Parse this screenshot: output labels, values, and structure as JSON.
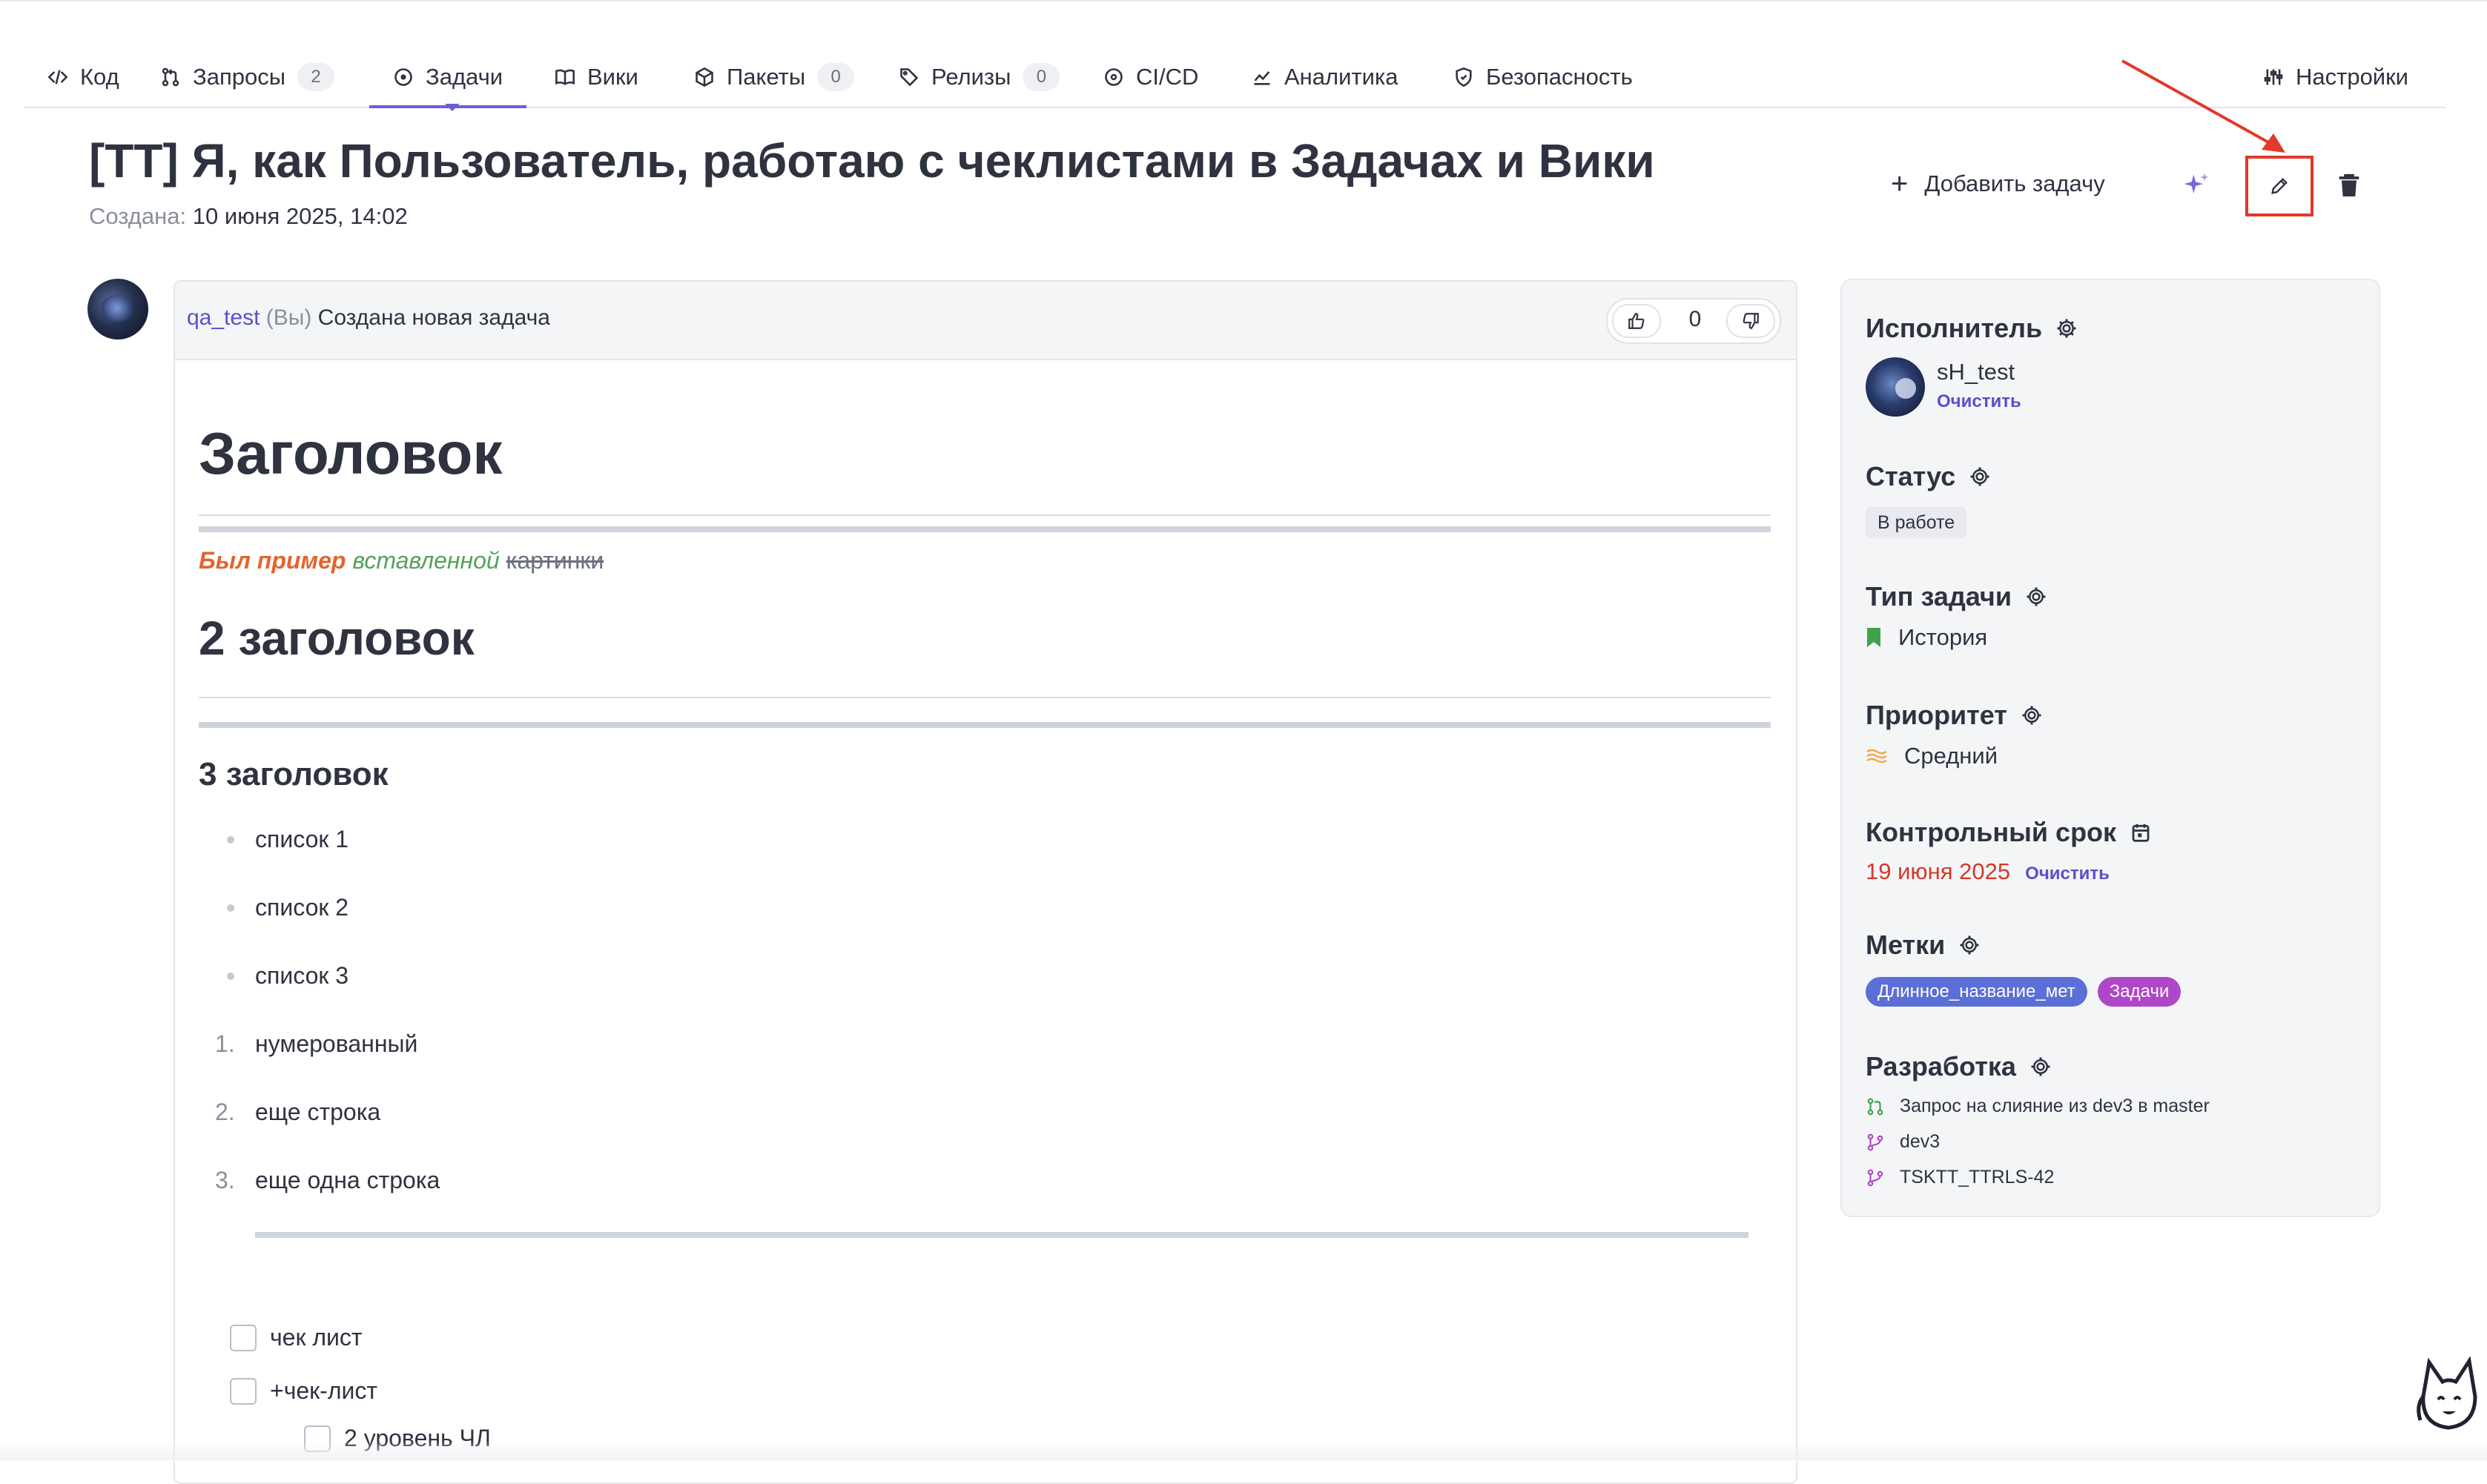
{
  "tabs": [
    {
      "label": "Код",
      "icon": "code-icon"
    },
    {
      "label": "Запросы",
      "count": "2",
      "icon": "merge-request-icon"
    },
    {
      "label": "Задачи",
      "icon": "issue-circle-icon",
      "active": true
    },
    {
      "label": "Вики",
      "icon": "book-icon"
    },
    {
      "label": "Пакеты",
      "count": "0",
      "icon": "package-icon"
    },
    {
      "label": "Релизы",
      "count": "0",
      "icon": "tag-icon"
    },
    {
      "label": "CI/CD",
      "icon": "pipeline-icon"
    },
    {
      "label": "Аналитика",
      "icon": "chart-line-icon"
    },
    {
      "label": "Безопасность",
      "icon": "shield-icon"
    },
    {
      "label": "Настройки",
      "icon": "sliders-icon"
    }
  ],
  "issue": {
    "title": "[TT] Я, как Пользователь, работаю с чеклистами в Задачах и Вики",
    "created_label": "Создана:",
    "created_value": "10 июня 2025, 14:02"
  },
  "actions": {
    "add_task": "Добавить задачу",
    "accent": "#e2392a"
  },
  "comment": {
    "user": "qa_test",
    "you": "(Вы)",
    "action": "Создана новая задача",
    "votes": "0",
    "body": {
      "h1": "Заголовок",
      "styled": [
        "Был пример",
        "вставленной",
        "картинки"
      ],
      "h2": "2 заголовок",
      "h3": "3 заголовок",
      "bullets": [
        "список 1",
        "список 2",
        "список 3"
      ],
      "numbered": [
        {
          "n": "1.",
          "text": "нумерованный"
        },
        {
          "n": "2.",
          "text": "еще строка"
        },
        {
          "n": "3.",
          "text": "еще одна строка"
        }
      ],
      "checklist": [
        "чек лист",
        "+чек-лист",
        "2 уровень ЧЛ"
      ]
    }
  },
  "sidebar": {
    "assignee": {
      "title": "Исполнитель",
      "name": "sH_test",
      "clear": "Очистить"
    },
    "status": {
      "title": "Статус",
      "value": "В работе"
    },
    "type": {
      "title": "Тип задачи",
      "value": "История",
      "color": "#3fa34d"
    },
    "priority": {
      "title": "Приоритет",
      "value": "Средний",
      "color": "#f2a93b"
    },
    "due": {
      "title": "Контрольный срок",
      "value": "19 июня 2025",
      "clear": "Очистить",
      "color": "#d2392b"
    },
    "labels": {
      "title": "Метки",
      "items": [
        {
          "text": "Длинное_название_мет",
          "color": "#5b6fd6"
        },
        {
          "text": "Задачи",
          "color": "#b046c8"
        }
      ]
    },
    "dev": {
      "title": "Разработка",
      "items": [
        {
          "text": "Запрос на слияние из dev3 в master",
          "icon": "merge-request-icon"
        },
        {
          "text": "dev3",
          "icon": "branch-icon"
        },
        {
          "text": "TSKTT_TTRLS-42",
          "icon": "branch-icon"
        }
      ]
    }
  }
}
